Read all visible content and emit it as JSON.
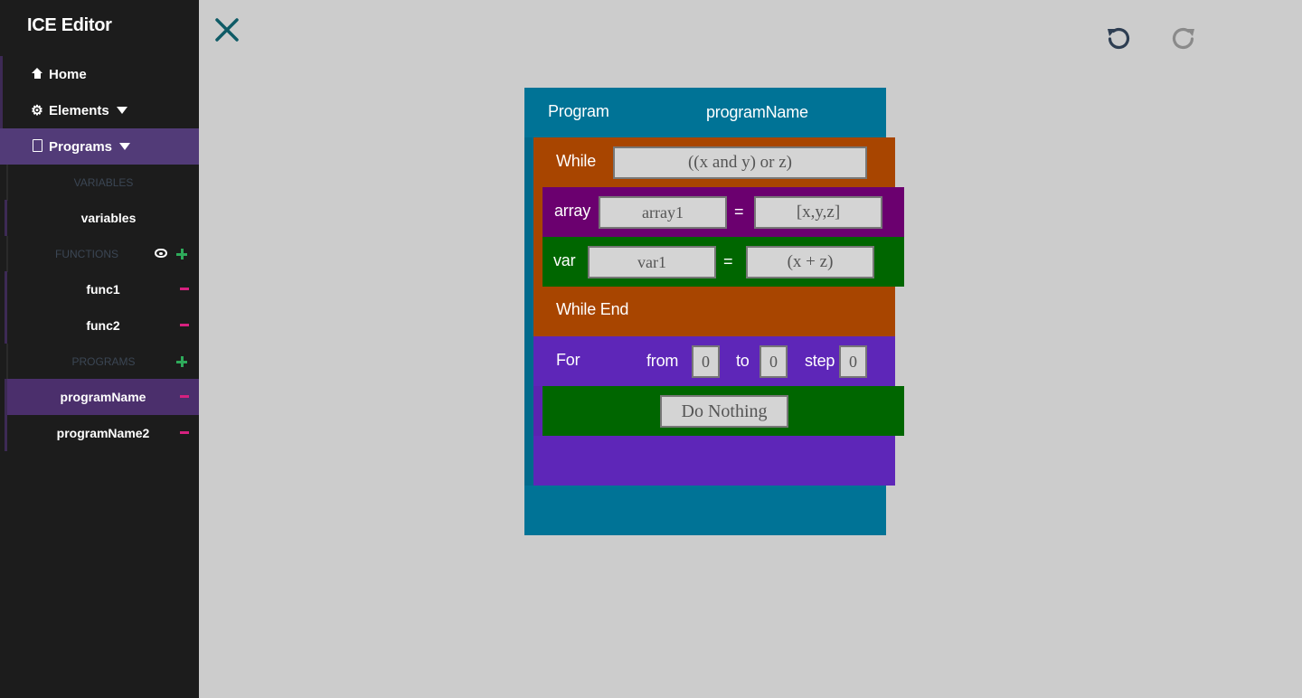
{
  "app": {
    "title": "ICE Editor"
  },
  "sidebar": {
    "nav": [
      {
        "label": "Home",
        "icon": "home-icon"
      },
      {
        "label": "Elements",
        "icon": "gear-icon"
      },
      {
        "label": "Programs",
        "icon": "document-icon"
      }
    ],
    "variables_heading": "VARIABLES",
    "variables_item": "variables",
    "functions_heading": "FUNCTIONS",
    "functions": [
      "func1",
      "func2"
    ],
    "programs_heading": "PROGRAMS",
    "programs": [
      "programName",
      "programName2"
    ],
    "active_program": "programName"
  },
  "toolbar": {
    "close_icon": "close-icon",
    "undo_icon": "undo-icon",
    "redo_icon": "redo-icon"
  },
  "program": {
    "keyword": "Program",
    "name": "programName",
    "while": {
      "keyword": "While",
      "condition": "((x and y) or z)",
      "end_keyword": "While End"
    },
    "array": {
      "keyword": "array",
      "name": "array1",
      "equals": "=",
      "value": "[x,y,z]"
    },
    "var": {
      "keyword": "var",
      "name": "var1",
      "equals": "=",
      "value": "(x + z)"
    },
    "for": {
      "keyword": "For",
      "from_label": "from",
      "from_value": "0",
      "to_label": "to",
      "to_value": "0",
      "step_label": "step",
      "step_value": "0"
    },
    "do_nothing": "Do Nothing"
  },
  "colors": {
    "sidebar_bg": "#1c1c1c",
    "canvas_bg": "#cccccc",
    "program_block": "#007396",
    "while_block": "#a84500",
    "array_block": "#6b006f",
    "var_block": "#006600",
    "for_block": "#5e26b8",
    "active_purple": "#523b78",
    "minus": "#d6217f",
    "plus": "#2eaa5a"
  }
}
